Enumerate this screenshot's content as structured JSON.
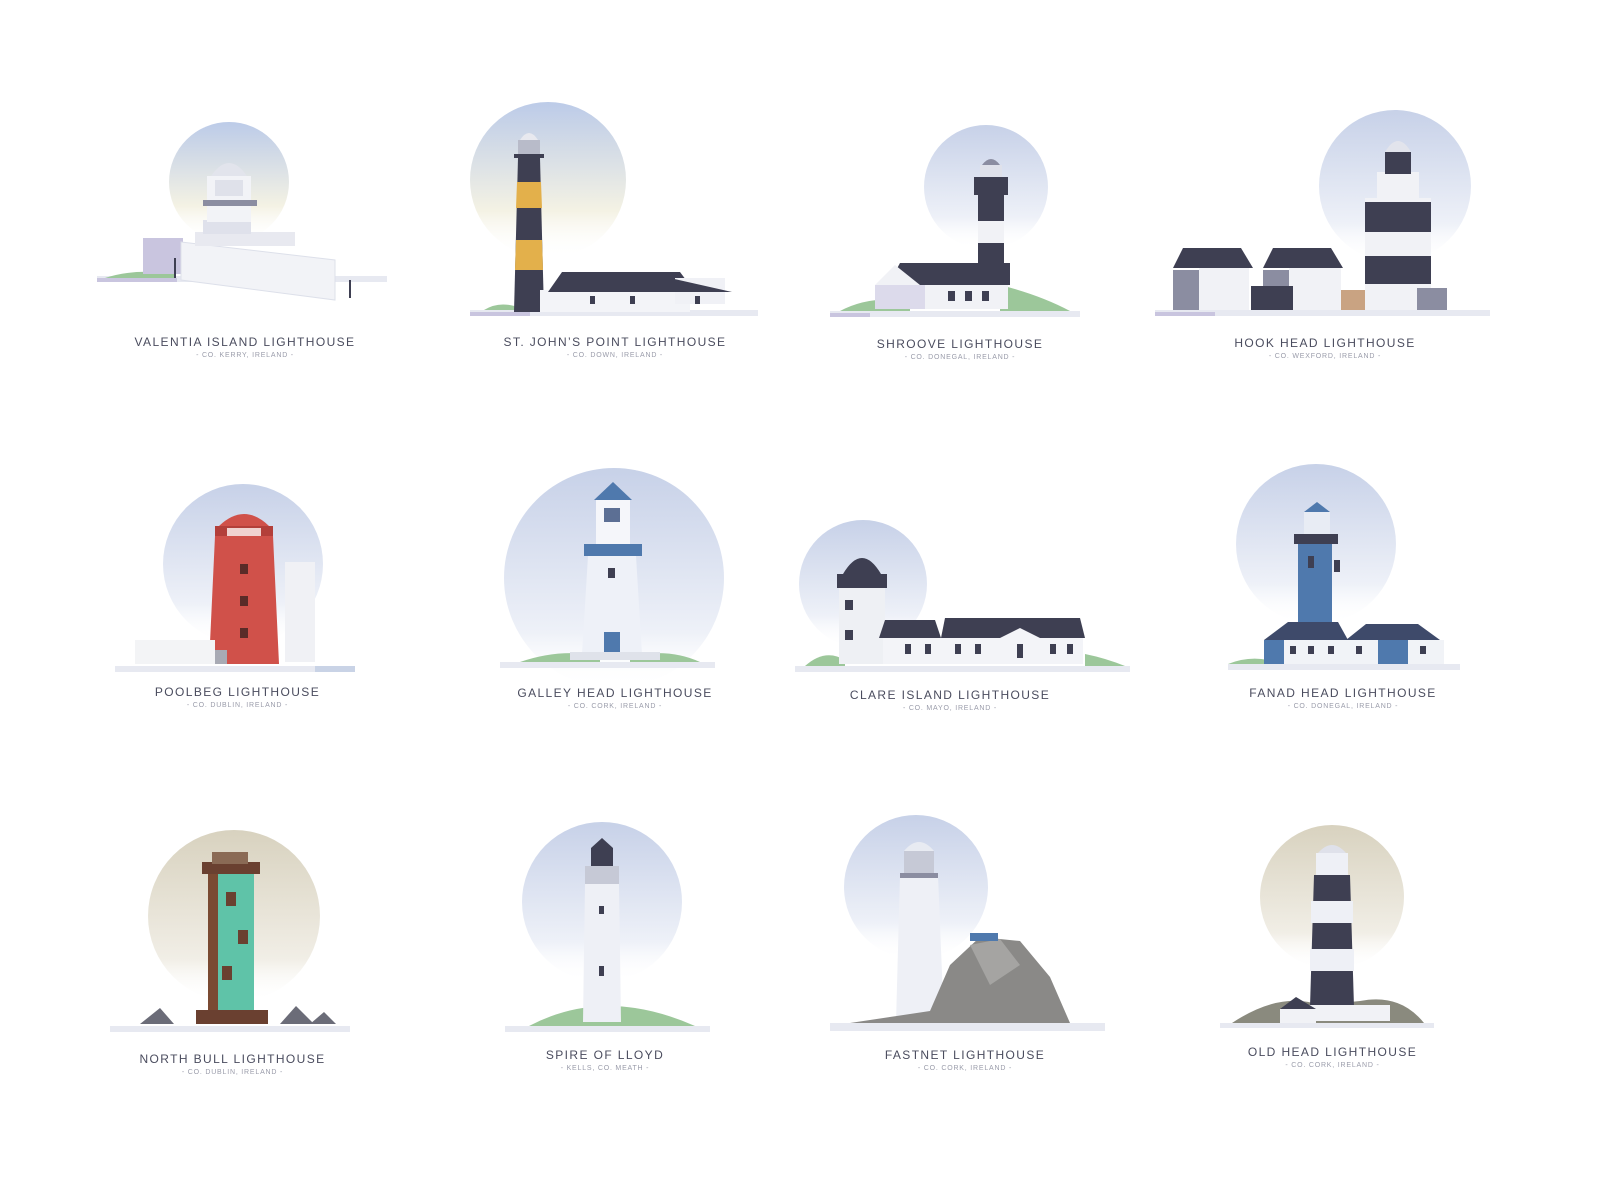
{
  "lighthouses": [
    {
      "title": "VALENTIA ISLAND LIGHTHOUSE",
      "subtitle": "- CO. KERRY, IRELAND -"
    },
    {
      "title": "ST. JOHN’S POINT LIGHTHOUSE",
      "subtitle": "- CO. DOWN, IRELAND -"
    },
    {
      "title": "SHROOVE LIGHTHOUSE",
      "subtitle": "- CO. DONEGAL, IRELAND -"
    },
    {
      "title": "HOOK HEAD LIGHTHOUSE",
      "subtitle": "- CO. WEXFORD, IRELAND -"
    },
    {
      "title": "POOLBEG LIGHTHOUSE",
      "subtitle": "- CO. DUBLIN, IRELAND -"
    },
    {
      "title": "GALLEY HEAD LIGHTHOUSE",
      "subtitle": "- CO. CORK, IRELAND -"
    },
    {
      "title": "CLARE ISLAND LIGHTHOUSE",
      "subtitle": "- CO. MAYO, IRELAND -"
    },
    {
      "title": "FANAD HEAD LIGHTHOUSE",
      "subtitle": "- CO. DONEGAL, IRELAND -"
    },
    {
      "title": "NORTH BULL LIGHTHOUSE",
      "subtitle": "- CO. DUBLIN, IRELAND -"
    },
    {
      "title": "SPIRE OF LLOYD",
      "subtitle": "- KELLS, CO. MEATH -"
    },
    {
      "title": "FASTNET LIGHTHOUSE",
      "subtitle": "- CO. CORK, IRELAND -"
    },
    {
      "title": "OLD HEAD LIGHTHOUSE",
      "subtitle": "- CO. CORK, IRELAND -"
    }
  ],
  "colors": {
    "sky_blue": "#d5dcec",
    "sky_warm": "#e3ddcc",
    "tower_dark": "#3e3f52",
    "tower_yellow": "#e3b04b",
    "poolbeg_red": "#d0514a",
    "fanad_blue": "#4f79ad",
    "green_grass": "#9cc79a",
    "rust_teal": "#5fc3a8",
    "rock_grey": "#8a8987"
  }
}
